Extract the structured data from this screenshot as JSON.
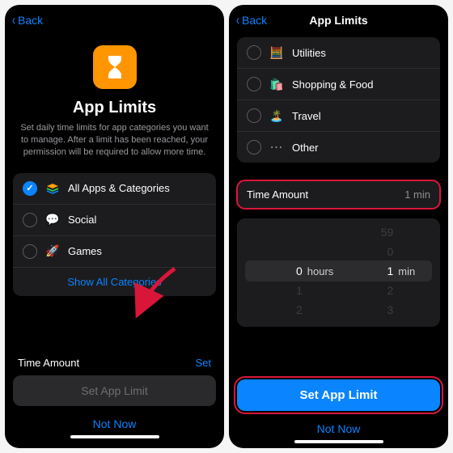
{
  "left": {
    "back": "Back",
    "title": "App Limits",
    "description": "Set daily time limits for app categories you want to manage. After a limit has been reached, your permission will be required to allow more time.",
    "categories": [
      {
        "icon": "layers",
        "label": "All Apps & Categories",
        "checked": true
      },
      {
        "icon": "💬",
        "label": "Social",
        "checked": false
      },
      {
        "icon": "🚀",
        "label": "Games",
        "checked": false
      }
    ],
    "show_all": "Show All Categories",
    "time_amount_label": "Time Amount",
    "set_label": "Set",
    "set_limit_btn": "Set App Limit",
    "not_now": "Not Now"
  },
  "right": {
    "back": "Back",
    "nav_title": "App Limits",
    "categories": [
      {
        "icon": "🧮",
        "label": "Utilities"
      },
      {
        "icon": "🛍️",
        "label": "Shopping & Food"
      },
      {
        "icon": "🏝️",
        "label": "Travel"
      },
      {
        "icon": "…",
        "label": "Other",
        "ellipsis": true
      }
    ],
    "time_amount_label": "Time Amount",
    "time_amount_value": "1 min",
    "picker": {
      "hours_above": "",
      "hours_sel": "0",
      "hours_below1": "1",
      "hours_below2": "2",
      "hours_label": "hours",
      "min_above2": "59",
      "min_above": "0",
      "min_sel": "1",
      "min_below1": "2",
      "min_below2": "3",
      "min_label": "min"
    },
    "set_limit_btn": "Set App Limit",
    "not_now": "Not Now"
  }
}
